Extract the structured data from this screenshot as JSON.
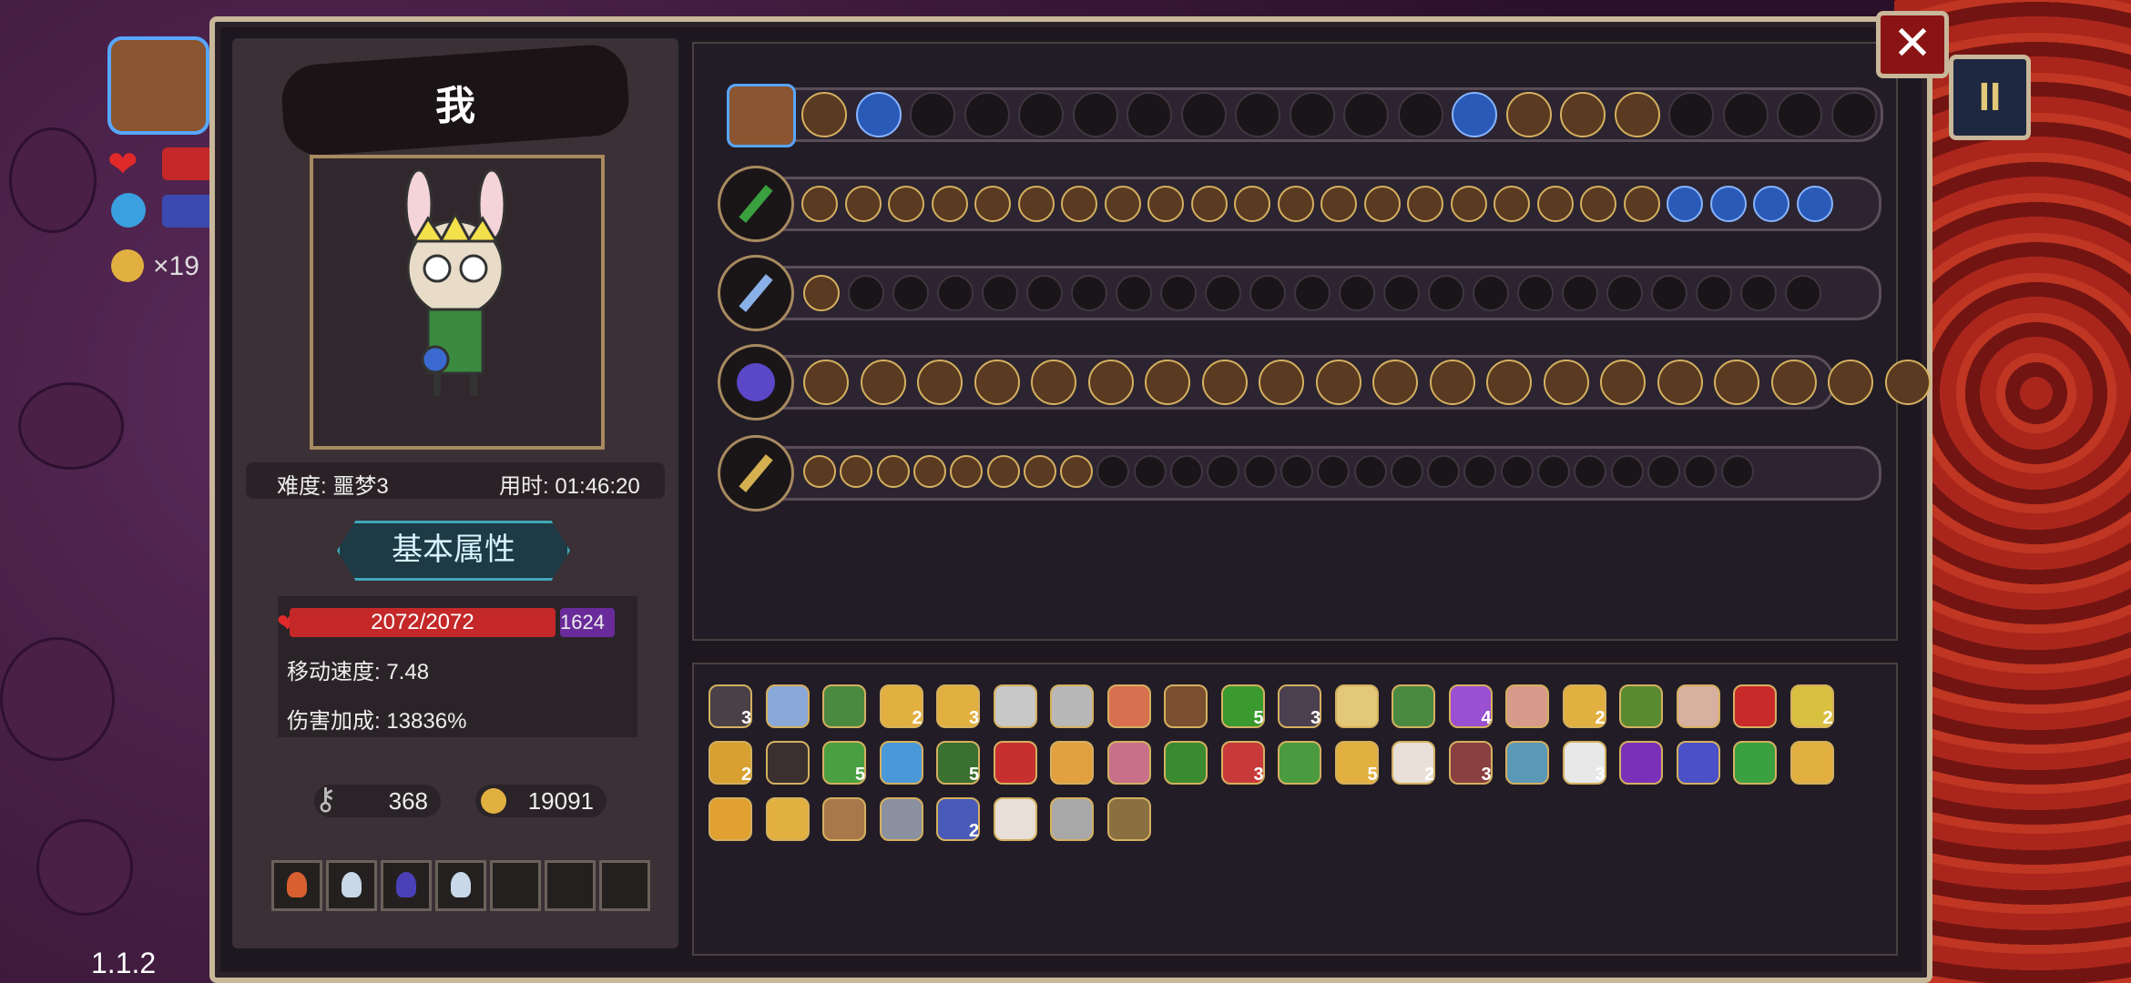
{
  "version": "1.1.2",
  "hud": {
    "coin_count": "×19"
  },
  "character": {
    "name": "我",
    "difficulty": "难度: 噩梦3",
    "time": "用时: 01:46:20"
  },
  "attr_tab_label": "基本属性",
  "stats": {
    "hp": "2072/2072",
    "mp": "1624",
    "move_speed": "移动速度: 7.48",
    "damage_bonus": "伤害加成: 13836%"
  },
  "currency": {
    "keys": "368",
    "coins": "19091"
  },
  "close_symbol": "✕",
  "pause_symbol": "II",
  "item_counts": [
    "3",
    "2",
    "3",
    "5",
    "3",
    "4",
    "2",
    "2",
    "2",
    "5",
    "5",
    "3",
    "5",
    "2",
    "3",
    "3",
    "2",
    "3",
    "2"
  ]
}
